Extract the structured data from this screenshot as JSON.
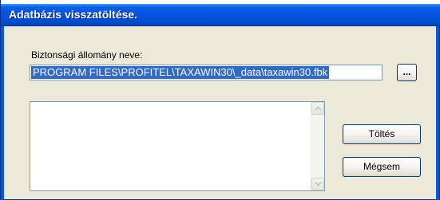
{
  "window": {
    "title": "Adatbázis visszatöltése."
  },
  "form": {
    "file_label": "Biztonsági állomány neve:",
    "file_path_value": "PROGRAM FILES\\PROFITEL\\TAXAWIN30\\_data\\taxawin30.fbk",
    "browse_label": "...",
    "load_label": "Töltés",
    "cancel_label": "Mégsem"
  },
  "icons": {
    "scroll_up": "arrow-up-icon",
    "scroll_down": "arrow-down-icon"
  },
  "colors": {
    "titlebar": "#0553df",
    "selection": "#316ac5",
    "dialog_bg": "#ece9d8"
  }
}
